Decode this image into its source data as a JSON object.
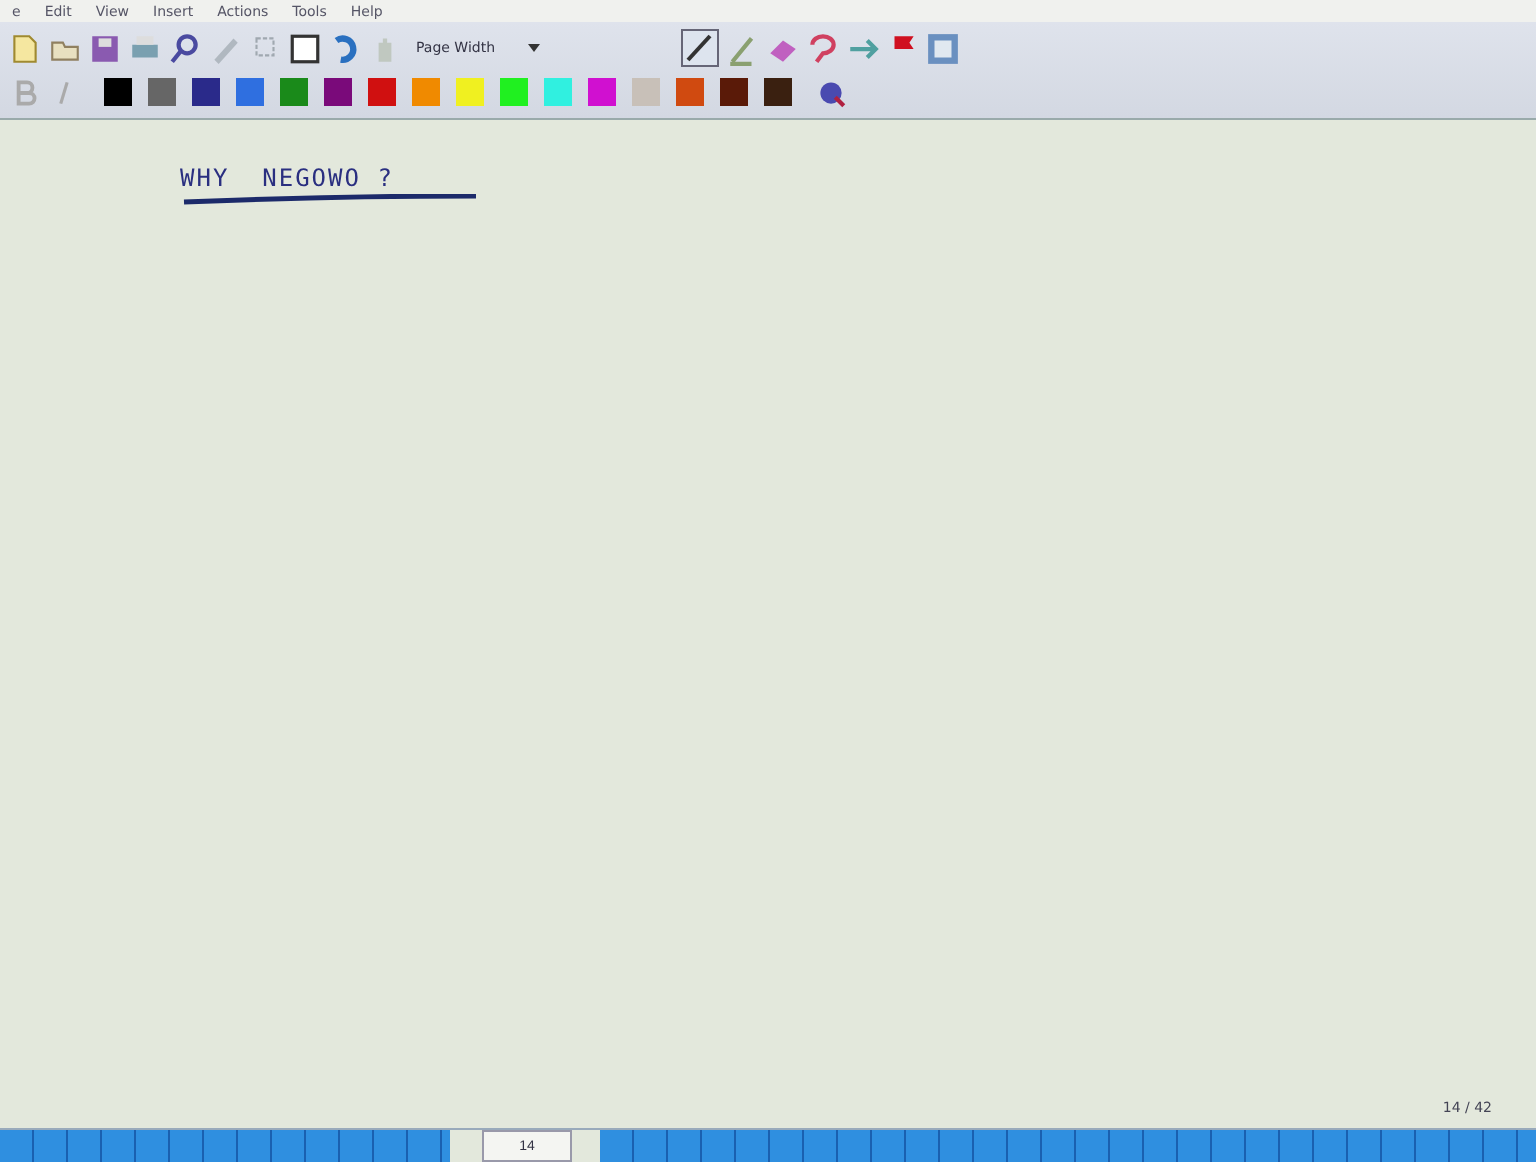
{
  "menu": [
    "e",
    "Edit",
    "View",
    "Insert",
    "Actions",
    "Tools",
    "Help"
  ],
  "toolbar": {
    "zoom": "Page Width"
  },
  "palette": [
    {
      "color": "#000000"
    },
    {
      "color": "#666666"
    },
    {
      "color": "#2a2a8a"
    },
    {
      "color": "#2f6fe0"
    },
    {
      "color": "#1a8a1a"
    },
    {
      "color": "#7a0a7a"
    },
    {
      "color": "#d01010"
    },
    {
      "color": "#f08a00"
    },
    {
      "color": "#f0f020"
    },
    {
      "color": "#20f020"
    },
    {
      "color": "#30f0e0"
    },
    {
      "color": "#d010d0"
    },
    {
      "color": "#c8c0b8"
    },
    {
      "color": "#d04a10"
    },
    {
      "color": "#5a1a08"
    },
    {
      "color": "#3a2010"
    }
  ],
  "note": {
    "text": "WHY  NEGOWO ?"
  },
  "page_indicator": "14 / 42",
  "taskbar": {
    "tab": "14"
  }
}
